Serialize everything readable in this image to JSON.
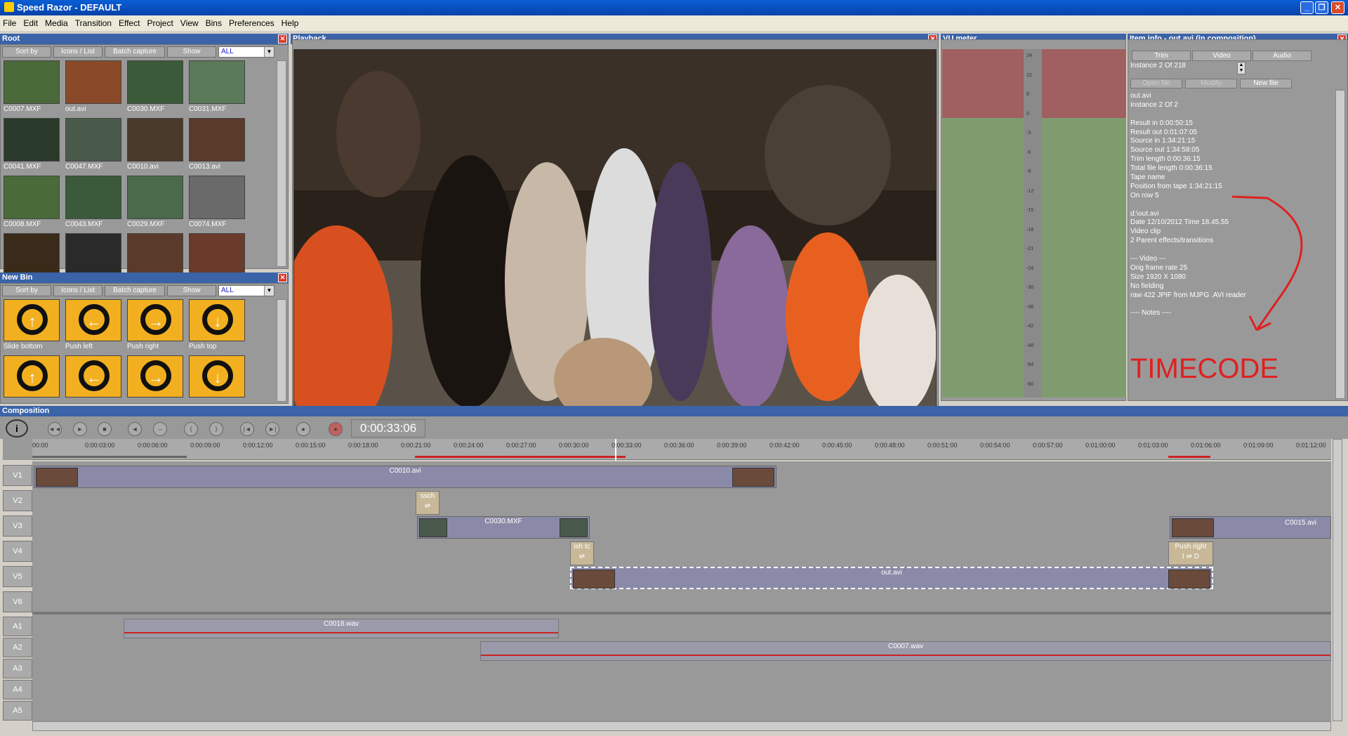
{
  "window": {
    "title": "Speed Razor - DEFAULT"
  },
  "menu": [
    "File",
    "Edit",
    "Media",
    "Transition",
    "Effect",
    "Project",
    "View",
    "Bins",
    "Preferences",
    "Help"
  ],
  "root_bin": {
    "title": "Root",
    "toolbar": {
      "sort": "Sort by",
      "icons": "Icons / List",
      "batch": "Batch capture",
      "show": "Show",
      "filter": "ALL"
    },
    "items": [
      {
        "label": "C0007.MXF",
        "color": "#4a6a3a"
      },
      {
        "label": "out.avi",
        "color": "#8a4a2a"
      },
      {
        "label": "C0030.MXF",
        "color": "#3a5a3a"
      },
      {
        "label": "C0031.MXF",
        "color": "#5a7a5a"
      },
      {
        "label": "C0041.MXF",
        "color": "#2a3a2a"
      },
      {
        "label": "C0047.MXF",
        "color": "#4a5a4a"
      },
      {
        "label": "C0010.avi",
        "color": "#4a3a2a"
      },
      {
        "label": "C0013.avi",
        "color": "#5a3a2a"
      },
      {
        "label": "C0008.MXF",
        "color": "#4a6a3a"
      },
      {
        "label": "C0043.MXF",
        "color": "#3a5a3a"
      },
      {
        "label": "C0029.MXF",
        "color": "#4a6a4a"
      },
      {
        "label": "C0074.MXF",
        "color": "#6a6a6a"
      },
      {
        "label": "",
        "color": "#3a2a1a"
      },
      {
        "label": "",
        "color": "#2a2a2a"
      },
      {
        "label": "",
        "color": "#5a3a2a"
      },
      {
        "label": "",
        "color": "#6a3a2a"
      }
    ]
  },
  "new_bin": {
    "title": "New Bin",
    "toolbar": {
      "sort": "Sort by",
      "icons": "Icons / List",
      "batch": "Batch capture",
      "show": "Show",
      "filter": "ALL"
    },
    "items": [
      {
        "label": "Slide bottom",
        "arrow": "↑"
      },
      {
        "label": "Push left",
        "arrow": "←"
      },
      {
        "label": "Push right",
        "arrow": "→"
      },
      {
        "label": "Push top",
        "arrow": "↓"
      },
      {
        "label": "",
        "arrow": "↑"
      },
      {
        "label": "",
        "arrow": "←"
      },
      {
        "label": "",
        "arrow": "→"
      },
      {
        "label": "",
        "arrow": "↓"
      }
    ]
  },
  "playback": {
    "title": "Playback"
  },
  "vu": {
    "title": "VU meter",
    "scale": [
      "24",
      "12",
      "6",
      "0",
      "-3",
      "-6",
      "-9",
      "-12",
      "-15",
      "-18",
      "-21",
      "-24",
      "-30",
      "-36",
      "-42",
      "-48",
      "-54",
      "-60"
    ]
  },
  "item_info": {
    "title": "Item info - out.avi (in composition)",
    "tabs": [
      "Trim",
      "Video",
      "Audio"
    ],
    "instance": "Instance 2 Of 218",
    "buttons": [
      "Open file",
      "Modify",
      "New file"
    ],
    "lines": [
      "out.avi",
      "Instance 2 Of 2",
      "",
      "Result in 0:00:50:15",
      "Result out 0:01:07:05",
      "Source in 1:34:21:15",
      "Source out 1:34:58:05",
      "Trim length 0:00:36:15",
      "Total file length 0:00:36:15",
      "Tape name",
      "Position from tape 1:34:21:15",
      "On row 5",
      "",
      "d:\\out.avi",
      "Date 12/10/2012 Time 18.45.55",
      "Video clip",
      "2 Parent effects/transitions",
      "",
      "--- Video ---",
      "Orig frame rate 25",
      "Size 1920 X 1080",
      "No fielding",
      "raw 422 JPIF from MJPG .AVI reader",
      "",
      "---- Notes ----"
    ],
    "annotation": "TIMECODE"
  },
  "composition": {
    "title": "Composition",
    "timecode": "0:00:33:06",
    "ruler": [
      "00:00",
      "0:00:03:00",
      "0:00:06:00",
      "0:00:09:00",
      "0:00:12:00",
      "0:00:15:00",
      "0:00:18:00",
      "0:00:21:00",
      "0:00:24:00",
      "0:00:27:00",
      "0:00:30:00",
      "0:00:33:00",
      "0:00:36:00",
      "0:00:39:00",
      "0:00:42:00",
      "0:00:45:00",
      "0:00:48:00",
      "0:00:51:00",
      "0:00:54:00",
      "0:00:57:00",
      "0:01:00:00",
      "0:01:03:00",
      "0:01:06:00",
      "0:01:09:00",
      "0:01:12:00"
    ],
    "video_tracks": [
      "V1",
      "V2",
      "V3",
      "V4",
      "V5",
      "V6"
    ],
    "audio_tracks": [
      "A1",
      "A2",
      "A3",
      "A4",
      "A5"
    ],
    "clips": {
      "c1": "C0010.avi",
      "t1": "ssch",
      "c2": "C0030.MXF",
      "t2": "ish tc",
      "c3": "C0015.avi",
      "t3": "Push right",
      "c4": "out.avi",
      "a1": "C0018.wav",
      "a2": "C0007.wav"
    }
  }
}
